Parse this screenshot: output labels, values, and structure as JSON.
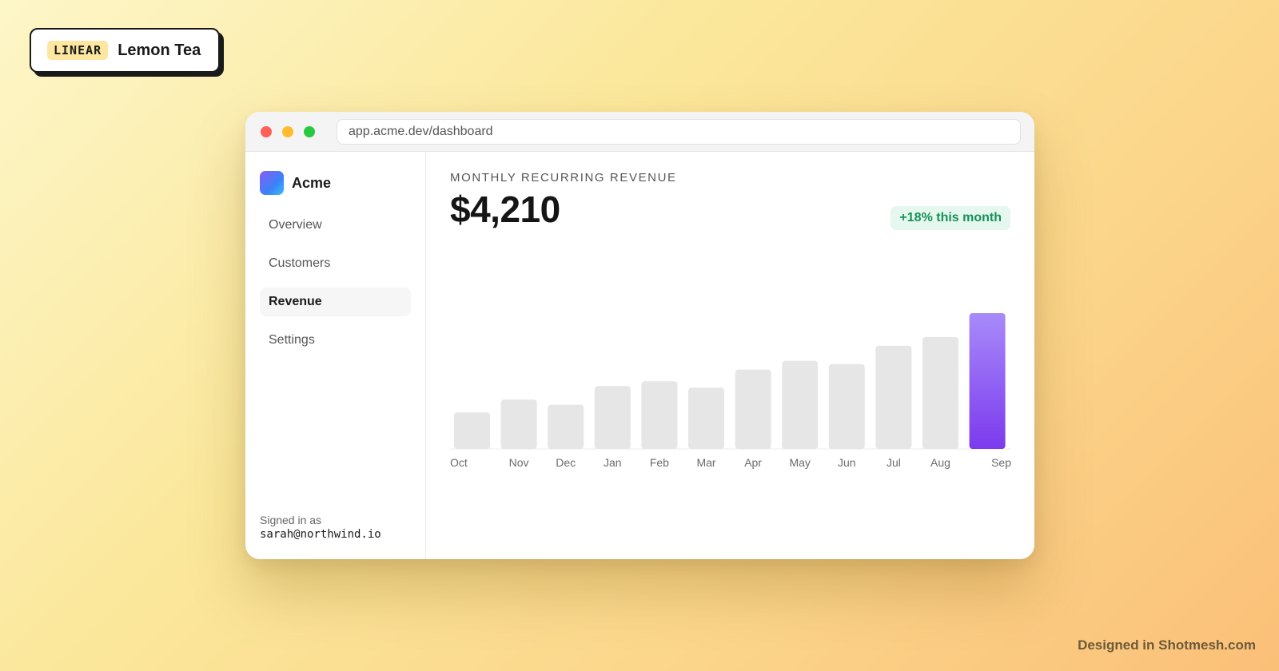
{
  "badge": {
    "tag": "LINEAR",
    "name": "Lemon Tea"
  },
  "browser": {
    "url": "app.acme.dev/dashboard"
  },
  "sidebar": {
    "app_name": "Acme",
    "items": [
      {
        "label": "Overview",
        "active": false
      },
      {
        "label": "Customers",
        "active": false
      },
      {
        "label": "Revenue",
        "active": true
      },
      {
        "label": "Settings",
        "active": false
      }
    ],
    "signed_in_label": "Signed in as",
    "signed_in_email": "sarah@northwind.io"
  },
  "main": {
    "metric_label": "MONTHLY RECURRING REVENUE",
    "metric_value": "$4,210",
    "delta": "+18% this month"
  },
  "colors": {
    "bar": "#e6e6e6",
    "highlight_top": "#a78bfa",
    "highlight_bottom": "#7c3aed",
    "delta_bg": "#e6f7ee",
    "delta_text": "#15915a"
  },
  "chart_data": {
    "type": "bar",
    "categories": [
      "Oct",
      "Nov",
      "Dec",
      "Jan",
      "Feb",
      "Mar",
      "Apr",
      "May",
      "Jun",
      "Jul",
      "Aug",
      "Sep"
    ],
    "values": [
      1130,
      1530,
      1370,
      1950,
      2100,
      1900,
      2460,
      2730,
      2630,
      3200,
      3470,
      4210
    ],
    "highlight_index": 11,
    "ylim": [
      0,
      4210
    ],
    "grid": false
  },
  "footer": {
    "credit": "Designed in Shotmesh.com"
  }
}
